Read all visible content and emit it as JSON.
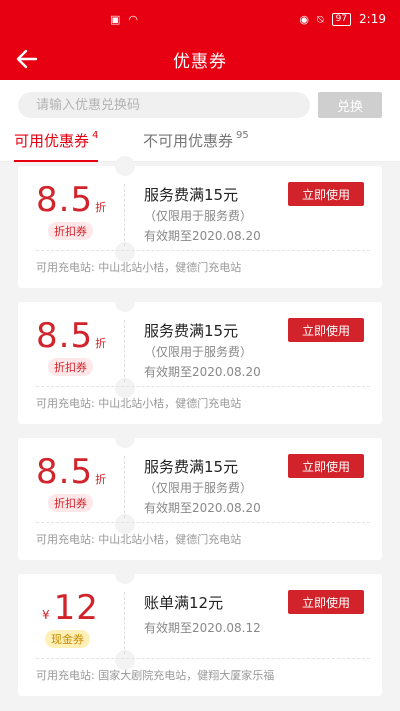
{
  "status_bar": {
    "time": "2:19",
    "battery": "97"
  },
  "header": {
    "title": "优惠券"
  },
  "search": {
    "placeholder": "请输入优惠兑换码",
    "button_label": "兑换"
  },
  "tabs": [
    {
      "label": "可用优惠券",
      "count": "4"
    },
    {
      "label": "不可用优惠券",
      "count": "95"
    }
  ],
  "coupons": [
    {
      "value": "8.5",
      "unit": "折",
      "badge": "折扣券",
      "title": "服务费满15元",
      "limit": "（仅限用于服务费）",
      "expiry": "有效期至2020.08.20",
      "action": "立即使用",
      "stations": "可用充电站: 中山北站小桔，健德门充电站"
    },
    {
      "value": "8.5",
      "unit": "折",
      "badge": "折扣券",
      "title": "服务费满15元",
      "limit": "（仅限用于服务费）",
      "expiry": "有效期至2020.08.20",
      "action": "立即使用",
      "stations": "可用充电站: 中山北站小桔，健德门充电站"
    },
    {
      "value": "8.5",
      "unit": "折",
      "badge": "折扣券",
      "title": "服务费满15元",
      "limit": "（仅限用于服务费）",
      "expiry": "有效期至2020.08.20",
      "action": "立即使用",
      "stations": "可用充电站: 中山北站小桔，健德门充电站"
    },
    {
      "currency": "¥",
      "value": "12",
      "badge": "现金券",
      "title": "账单满12元",
      "expiry": "有效期至2020.08.12",
      "action": "立即使用",
      "stations": "可用充电站: 国家大剧院充电站，健翔大厦家乐福"
    }
  ],
  "colors": {
    "brand_red": "#e60012",
    "coupon_red": "#d2232a",
    "cash_badge_bg": "#fff0b8"
  }
}
